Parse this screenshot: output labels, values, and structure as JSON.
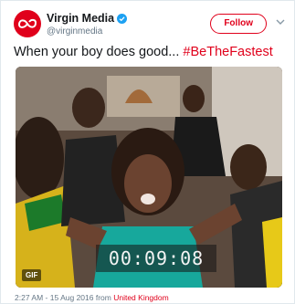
{
  "account": {
    "name": "Virgin Media",
    "handle": "@virginmedia",
    "verified_icon": "verified-badge-icon",
    "brand_color": "#e0001b"
  },
  "follow_button": {
    "label": "Follow"
  },
  "tweet": {
    "text": "When your boy does good... ",
    "hashtag": "#BeTheFastest"
  },
  "media": {
    "timer": "00:09:08",
    "badge": "GIF"
  },
  "meta": {
    "timestamp": "2:27 AM - 15 Aug 2016 from ",
    "location": "United Kingdom"
  }
}
